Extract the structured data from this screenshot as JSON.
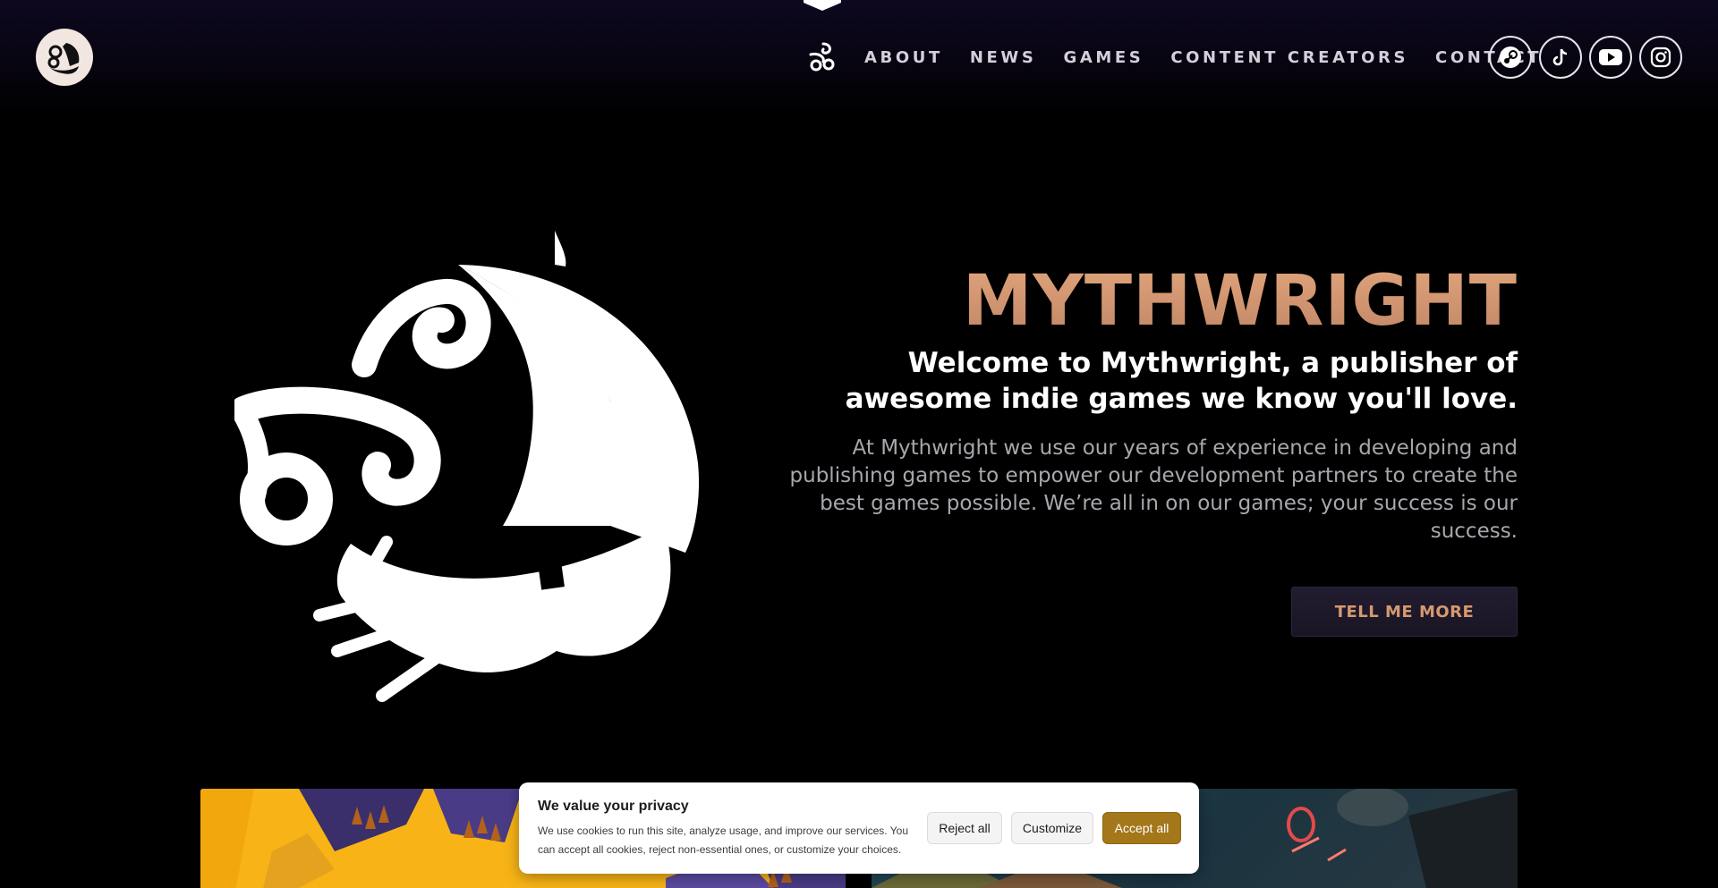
{
  "header": {
    "nav": [
      {
        "label": "ABOUT"
      },
      {
        "label": "NEWS"
      },
      {
        "label": "GAMES"
      },
      {
        "label": "CONTENT CREATORS"
      },
      {
        "label": "CONTACT"
      }
    ],
    "socials": [
      {
        "icon": "steam-icon"
      },
      {
        "icon": "tiktok-icon"
      },
      {
        "icon": "youtube-icon"
      },
      {
        "icon": "instagram-icon"
      }
    ]
  },
  "hero": {
    "title": "MYTHWRIGHT",
    "subtitle": "Welcome to Mythwright, a publisher of awesome indie games we know you'll love.",
    "body": "At Mythwright we use our years of experience in developing and publishing games to empower our development partners to create the best games possible. We’re all in on our games; your success is our success.",
    "cta_label": "TELL ME MORE"
  },
  "cookie": {
    "title": "We value your privacy",
    "text": "We use cookies to run this site, analyze usage, and improve our services. You can accept all cookies, reject non-essential ones, or customize your choices.",
    "reject_label": "Reject all",
    "customize_label": "Customize",
    "accept_label": "Accept all"
  },
  "colors": {
    "accent": "#d59a70",
    "accept_button": "#a3771a",
    "card_left": "#f8b416"
  }
}
